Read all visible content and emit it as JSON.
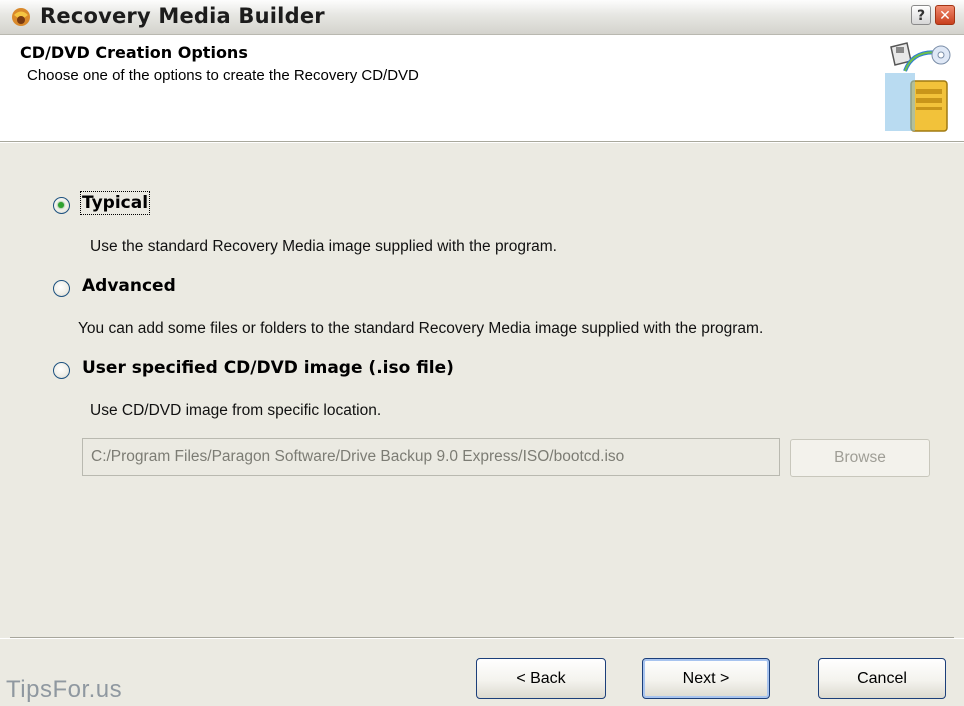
{
  "window": {
    "title": "Recovery Media Builder",
    "help_label": "?",
    "close_label": "✕"
  },
  "header": {
    "title": "CD/DVD Creation Options",
    "subtitle": "Choose one of the options to create the Recovery CD/DVD"
  },
  "options": [
    {
      "label": "Typical",
      "description": "Use the standard Recovery Media image supplied with the program.",
      "selected": true
    },
    {
      "label": "Advanced",
      "description": "You can add some files or folders to the standard Recovery Media image supplied with the program.",
      "selected": false
    },
    {
      "label": "User specified CD/DVD image (.iso file)",
      "description": "Use CD/DVD image from specific location.",
      "selected": false
    }
  ],
  "iso": {
    "path_value": "C:/Program Files/Paragon Software/Drive Backup 9.0 Express/ISO/bootcd.iso",
    "browse_label": "Browse"
  },
  "buttons": {
    "back": "< Back",
    "next": "Next >",
    "cancel": "Cancel"
  },
  "watermark": "TipsFor.us",
  "colors": {
    "dialog_background": "#ebeae2",
    "radio_checked": "#2fa22f",
    "button_border": "#1c3f7a"
  },
  "icons": [
    "app-icon",
    "help-icon",
    "close-icon",
    "recovery-media-graphic"
  ]
}
